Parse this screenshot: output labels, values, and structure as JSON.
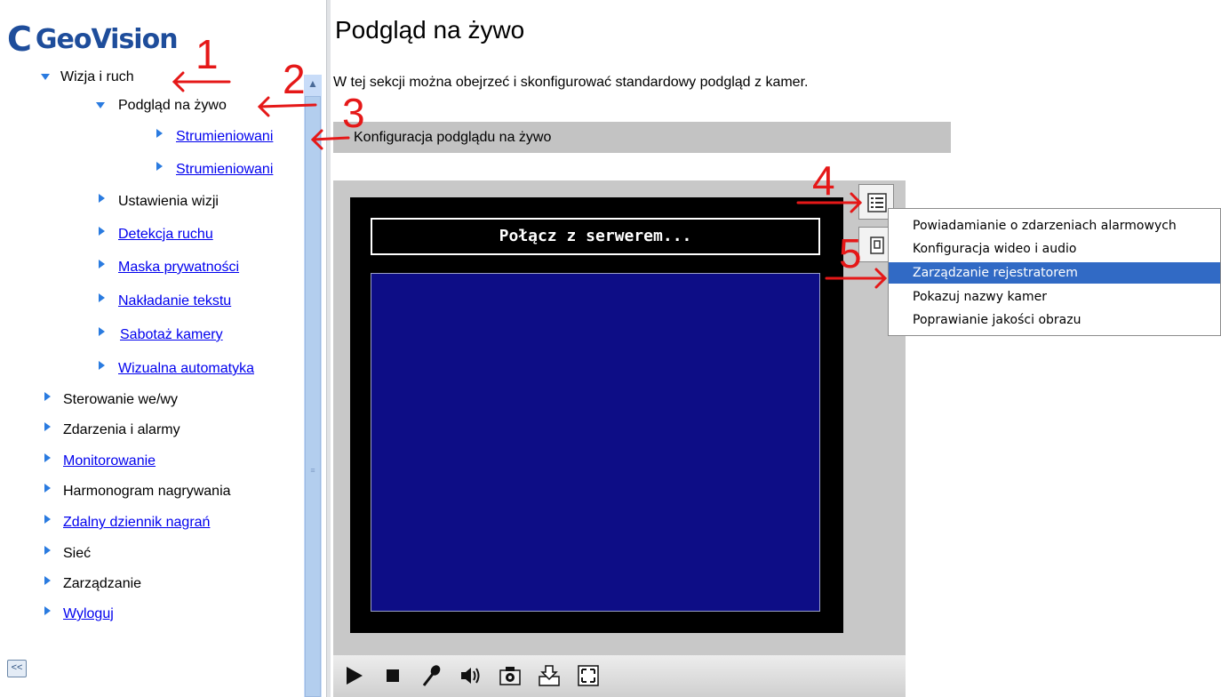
{
  "sidebar": {
    "logo_text": "GeoVision",
    "items": [
      {
        "label": "Wizja i ruch",
        "link": false,
        "expanded": true
      },
      {
        "label": "Podgląd na żywo",
        "link": false,
        "expanded": true
      },
      {
        "label": "Strumieniowani",
        "link": true
      },
      {
        "label": "Strumieniowani",
        "link": true
      },
      {
        "label": "Ustawienia wizji",
        "link": false
      },
      {
        "label": "Detekcja ruchu",
        "link": true
      },
      {
        "label": "Maska prywatności",
        "link": true
      },
      {
        "label": "Nakładanie tekstu",
        "link": true
      },
      {
        "label": "Sabotaż kamery",
        "link": true
      },
      {
        "label": "Wizualna automatyka",
        "link": true
      },
      {
        "label": "Sterowanie we/wy",
        "link": false
      },
      {
        "label": "Zdarzenia i alarmy",
        "link": false
      },
      {
        "label": "Monitorowanie",
        "link": true
      },
      {
        "label": "Harmonogram nagrywania",
        "link": false
      },
      {
        "label": "Zdalny dziennik nagrań",
        "link": true
      },
      {
        "label": "Sieć",
        "link": false
      },
      {
        "label": "Zarządzanie",
        "link": false
      },
      {
        "label": "Wyloguj",
        "link": true
      }
    ],
    "collapse_label": "<<"
  },
  "main": {
    "title": "Podgląd na żywo",
    "intro": "W tej sekcji można obejrzeć i skonfigurować standardowy podgląd z kamer.",
    "section_title": "Konfiguracja podglądu na żywo",
    "viewer": {
      "connect_text": "Połącz z serwerem..."
    }
  },
  "context_menu": {
    "items": [
      "Powiadamianie o zdarzeniach alarmowych",
      "Konfiguracja wideo i audio",
      "Zarządzanie rejestratorem",
      "Pokazuj nazwy kamer",
      "Poprawianie jakości obrazu"
    ],
    "selected_index": 2
  },
  "annotations": {
    "labels": [
      "1",
      "2",
      "3",
      "4",
      "5"
    ],
    "color": "#e51818"
  },
  "colors": {
    "link": "#0000ee",
    "tree_arrow": "#2a7be0",
    "logo": "#1e4d9b",
    "video_bg": "#0d0d86",
    "menu_selected": "#316ac5"
  },
  "icons": [
    "play-icon",
    "stop-icon",
    "microphone-icon",
    "speaker-icon",
    "snapshot-icon",
    "download-icon",
    "fullscreen-icon",
    "menu-list-icon",
    "recorder-icon"
  ]
}
